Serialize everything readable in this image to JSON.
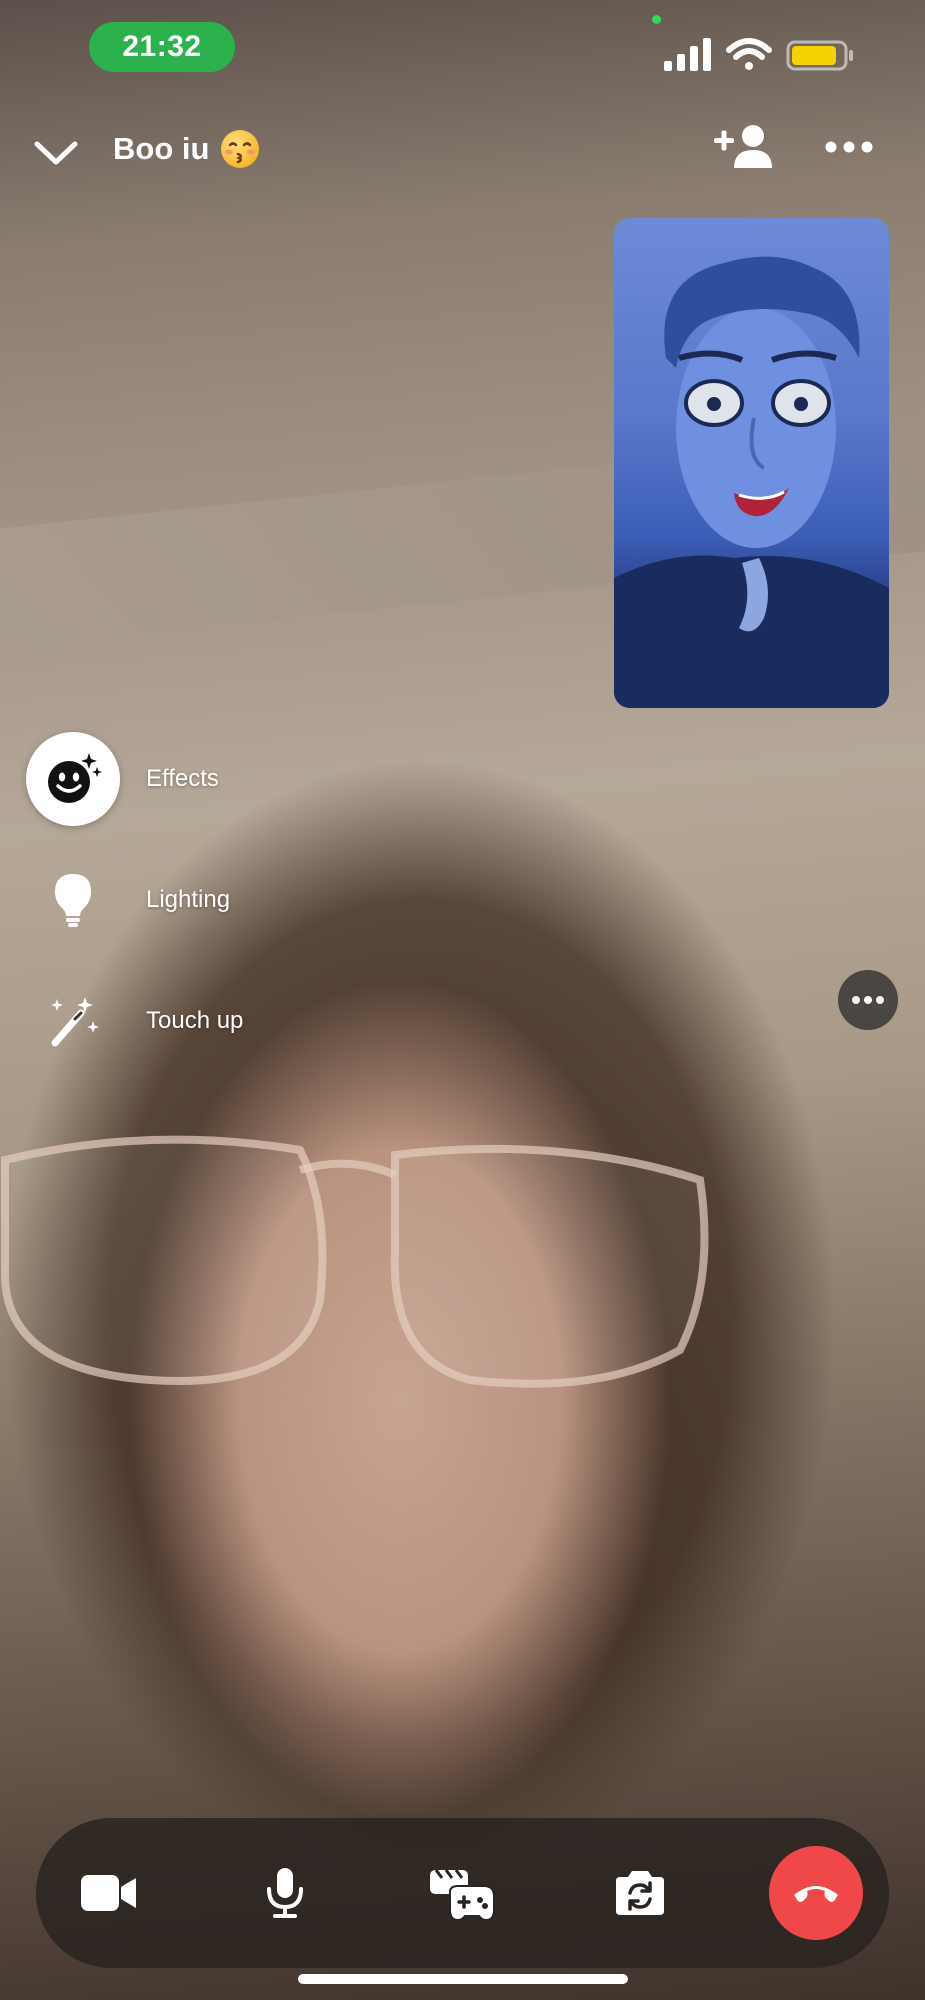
{
  "status_bar": {
    "time": "21:32",
    "icons": [
      "signal-icon",
      "wifi-icon",
      "battery-icon"
    ],
    "battery_color": "#f5d300",
    "time_pill_color": "#2bb24c"
  },
  "header": {
    "title": "Boo iu",
    "title_emoji": "kissing-face-emoji",
    "left_icon": "chevron-down-icon",
    "right_icons": [
      "add-person-icon",
      "more-horizontal-icon"
    ]
  },
  "effects_menu": {
    "items": [
      {
        "label": "Effects",
        "icon": "smiley-sparkle-icon",
        "selected": true
      },
      {
        "label": "Lighting",
        "icon": "lightbulb-icon",
        "selected": false
      },
      {
        "label": "Touch up",
        "icon": "magic-wand-icon",
        "selected": false
      }
    ]
  },
  "call_controls": {
    "buttons": [
      "video-camera-icon",
      "microphone-icon",
      "games-icon",
      "flip-camera-icon",
      "end-call-icon"
    ],
    "end_call_color": "#f04848"
  }
}
